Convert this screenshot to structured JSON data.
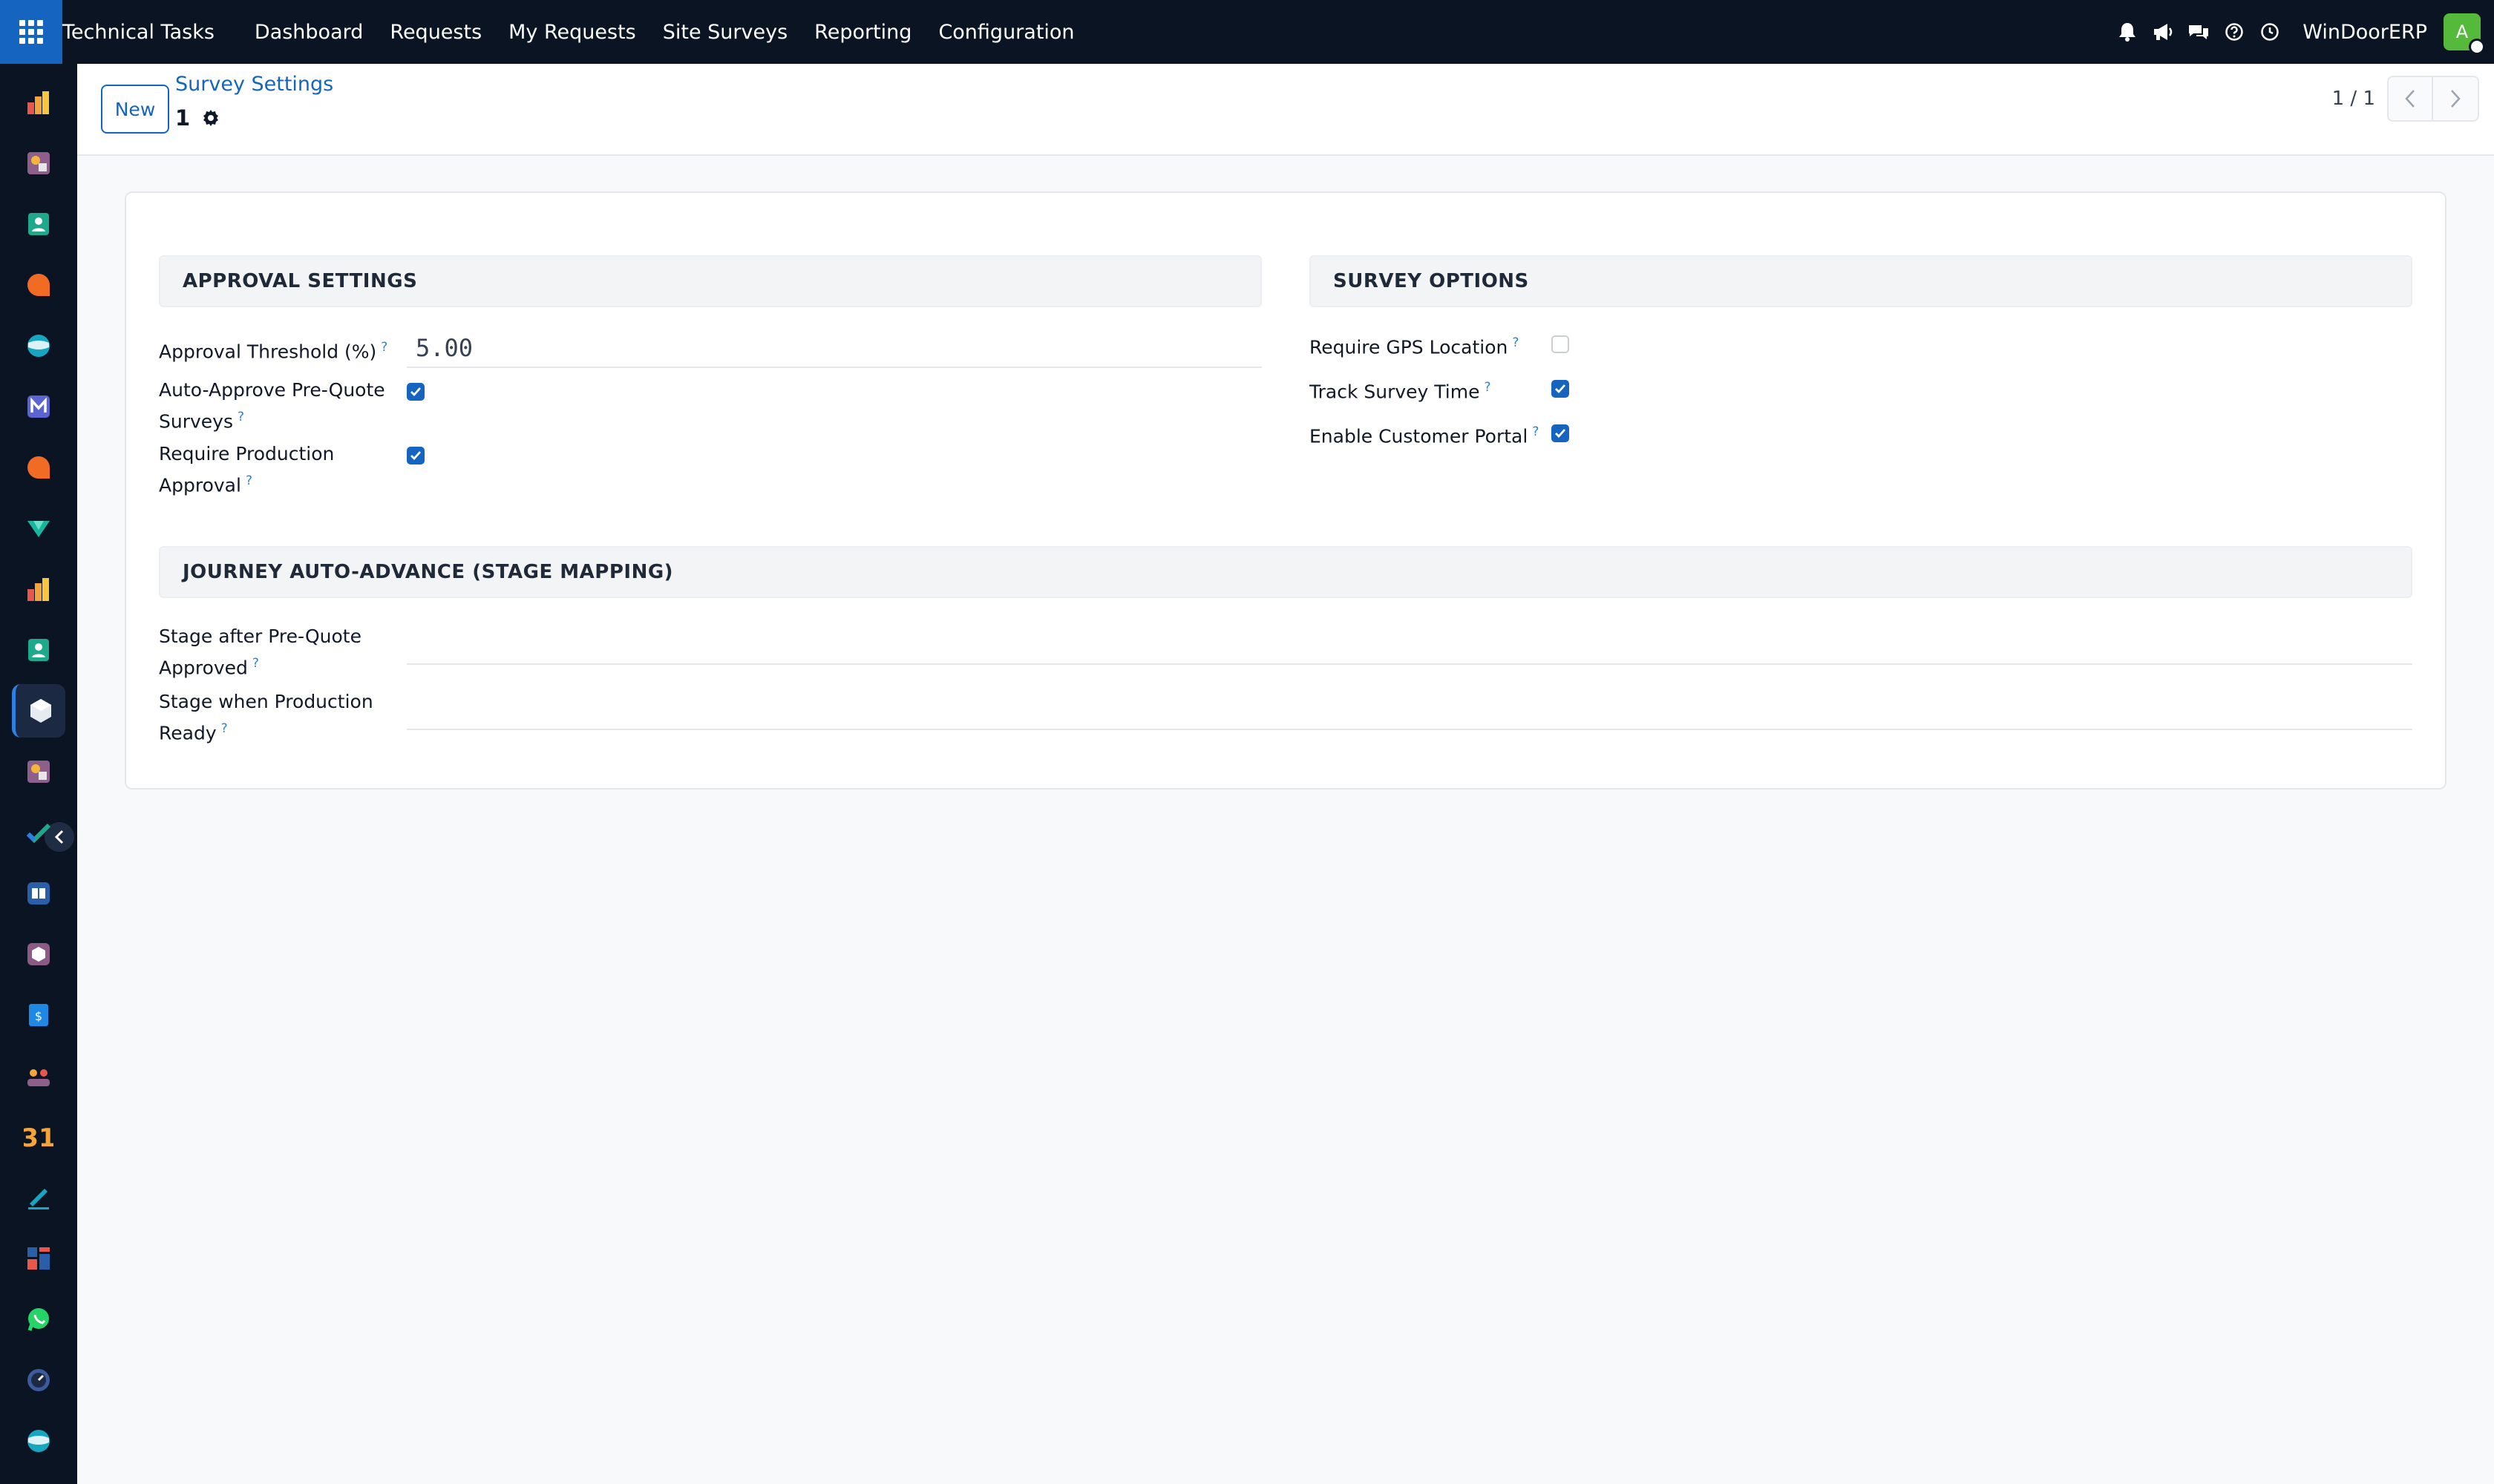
{
  "navbar": {
    "brand": "Technical Tasks",
    "menu": [
      "Dashboard",
      "Requests",
      "My Requests",
      "Site Surveys",
      "Reporting",
      "Configuration"
    ],
    "company": "WinDoorERP",
    "avatar_letter": "A"
  },
  "control_panel": {
    "new_label": "New",
    "breadcrumb": "Survey Settings",
    "record_name": "1",
    "pager": "1 / 1"
  },
  "approval": {
    "title": "APPROVAL SETTINGS",
    "threshold_label": "Approval Threshold (%)",
    "threshold_value": "5.00",
    "auto_approve_label_1": "Auto-Approve Pre-Quote",
    "auto_approve_label_2": "Surveys",
    "auto_approve_checked": true,
    "production_label_1": "Require Production",
    "production_label_2": "Approval",
    "production_checked": true
  },
  "survey_options": {
    "title": "SURVEY OPTIONS",
    "gps_label": "Require GPS Location",
    "gps_checked": false,
    "track_label": "Track Survey Time",
    "track_checked": true,
    "portal_label": "Enable Customer Portal",
    "portal_checked": true
  },
  "journey": {
    "title": "JOURNEY AUTO-ADVANCE (STAGE MAPPING)",
    "prequote_label_1": "Stage after Pre-Quote",
    "prequote_label_2": "Approved",
    "prequote_value": "",
    "production_label_1": "Stage when Production",
    "production_label_2": "Ready",
    "production_value": ""
  },
  "help_mark": "?",
  "colors": {
    "navbar_bg": "#0b1423",
    "primary": "#1565c0",
    "avatar": "#55b93b",
    "help": "#2b7fe0"
  }
}
